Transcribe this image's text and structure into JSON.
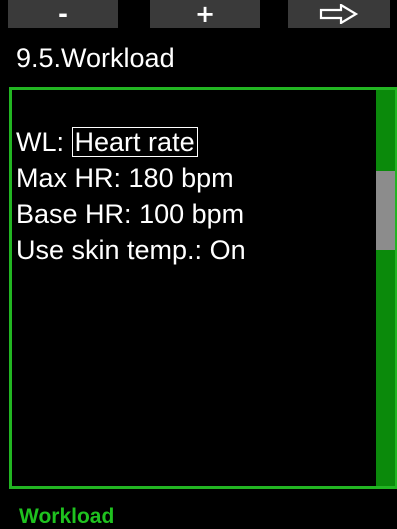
{
  "softkeys": {
    "left_label": "-",
    "middle_label": "+",
    "right_icon": "arrow-right-outline-icon"
  },
  "header": {
    "title": "9.5.Workload"
  },
  "settings": {
    "items": [
      {
        "label": "WL:",
        "value": "Heart rate",
        "selected": true
      },
      {
        "label": "Max HR:",
        "value": "180 bpm"
      },
      {
        "label": "Base HR:",
        "value": "100 bpm"
      },
      {
        "label": "Use skin temp.:",
        "value": "On"
      }
    ]
  },
  "footer": {
    "label": "Workload"
  },
  "colors": {
    "background": "#000000",
    "accent_green": "#22b522",
    "scrollbar_green": "#0b8a0b",
    "scroll_thumb": "#8c8c8c",
    "footer_text": "#1fc21f",
    "softkey_bg": "#3a3a3a"
  }
}
